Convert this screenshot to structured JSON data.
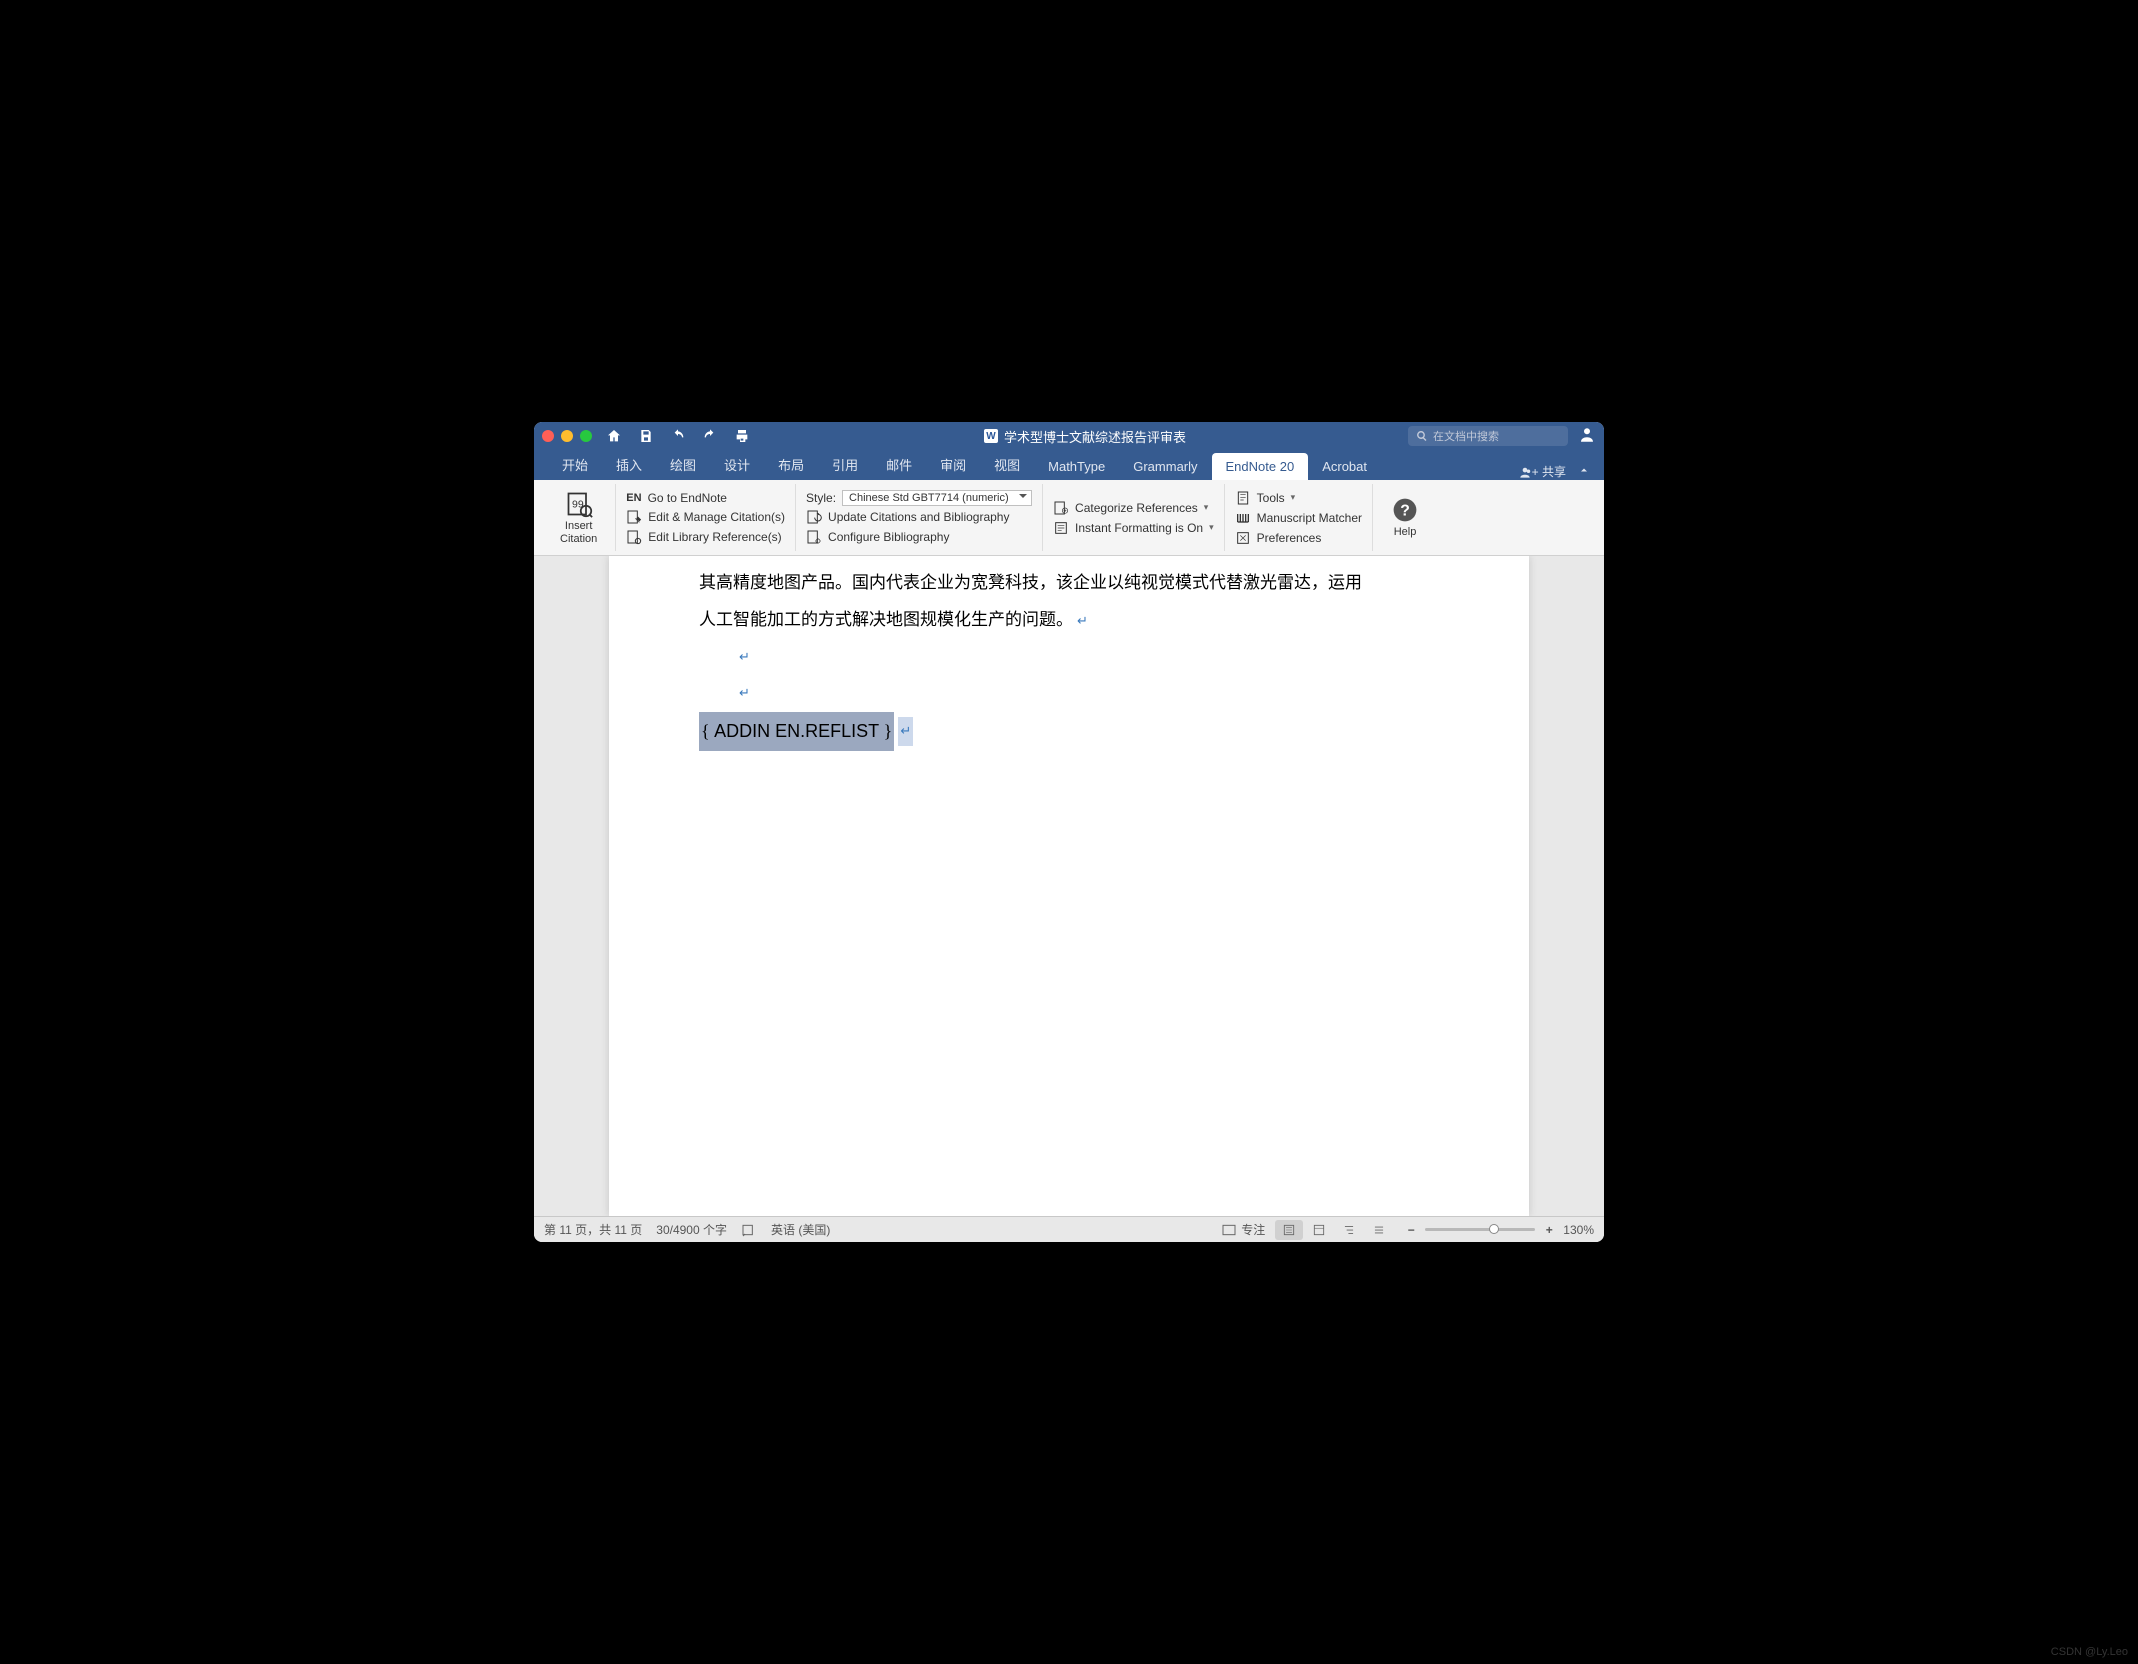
{
  "window": {
    "title": "学术型博士文献综述报告评审表",
    "search_placeholder": "在文档中搜索"
  },
  "tabs": {
    "items": [
      "开始",
      "插入",
      "绘图",
      "设计",
      "布局",
      "引用",
      "邮件",
      "审阅",
      "视图",
      "MathType",
      "Grammarly",
      "EndNote 20",
      "Acrobat"
    ],
    "active": "EndNote 20",
    "share": "共享"
  },
  "ribbon": {
    "insert_citation": "Insert\nCitation",
    "go_endnote_prefix": "EN",
    "go_endnote": "Go to EndNote",
    "edit_manage": "Edit & Manage Citation(s)",
    "edit_library": "Edit Library Reference(s)",
    "style_label": "Style:",
    "style_value": "Chinese Std GBT7714 (numeric)",
    "update_cit": "Update Citations and Bibliography",
    "config_bib": "Configure Bibliography",
    "categorize": "Categorize References",
    "instant_fmt": "Instant Formatting is On",
    "tools": "Tools",
    "manuscript": "Manuscript Matcher",
    "preferences": "Preferences",
    "help": "Help"
  },
  "document": {
    "line1": "其高精度地图产品。国内代表企业为宽凳科技，该企业以纯视觉模式代替激光雷达，运用",
    "line2": "人工智能加工的方式解决地图规模化生产的问题。",
    "field_code": "ADDIN EN.REFLIST"
  },
  "statusbar": {
    "page": "第 11 页，共 11 页",
    "words": "30/4900 个字",
    "lang": "英语 (美国)",
    "focus": "专注",
    "zoom": "130%"
  },
  "watermark": "CSDN @Ly.Leo"
}
